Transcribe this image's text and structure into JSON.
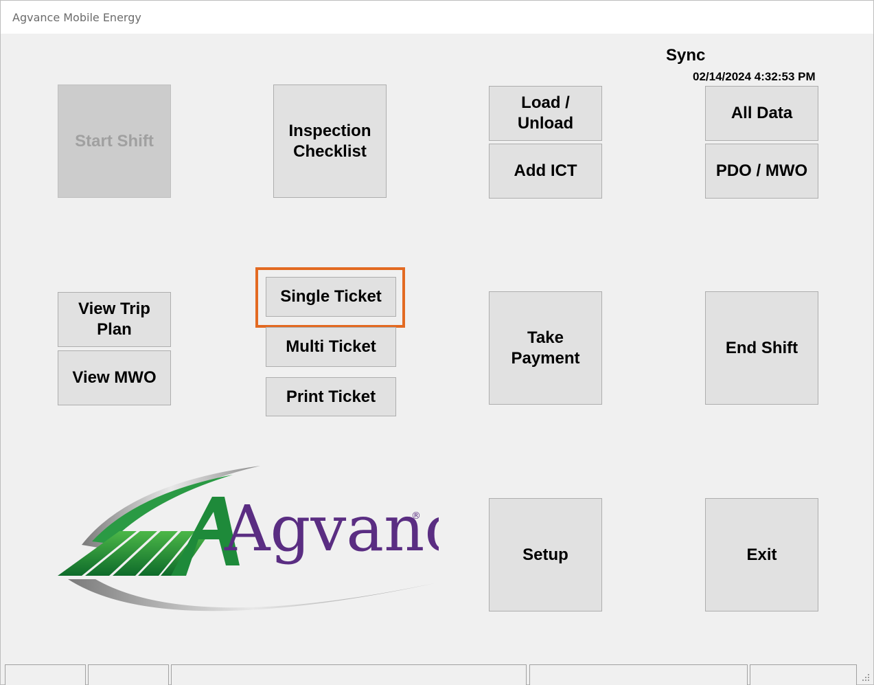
{
  "window": {
    "title": "Agvance Mobile Energy"
  },
  "sync": {
    "label": "Sync",
    "timestamp": "02/14/2024 4:32:53 PM"
  },
  "buttons": {
    "start_shift": "Start Shift",
    "inspection_checklist": "Inspection\nChecklist",
    "load_unload": "Load /\nUnload",
    "add_ict": "Add ICT",
    "all_data": "All Data",
    "pdo_mwo": "PDO / MWO",
    "view_trip_plan": "View Trip\nPlan",
    "view_mwo": "View MWO",
    "single_ticket": "Single Ticket",
    "multi_ticket": "Multi Ticket",
    "print_ticket": "Print Ticket",
    "take_payment": "Take\nPayment",
    "end_shift": "End Shift",
    "setup": "Setup",
    "exit": "Exit"
  },
  "logo": {
    "text": "Agvance",
    "registered": "®"
  },
  "colors": {
    "highlight": "#e36a22",
    "logo_green": "#1e8a3a",
    "logo_purple": "#5a2d82",
    "disabled_text": "#a0a0a0"
  },
  "status_bar": {
    "cells": [
      "",
      "",
      "",
      "",
      ""
    ]
  }
}
